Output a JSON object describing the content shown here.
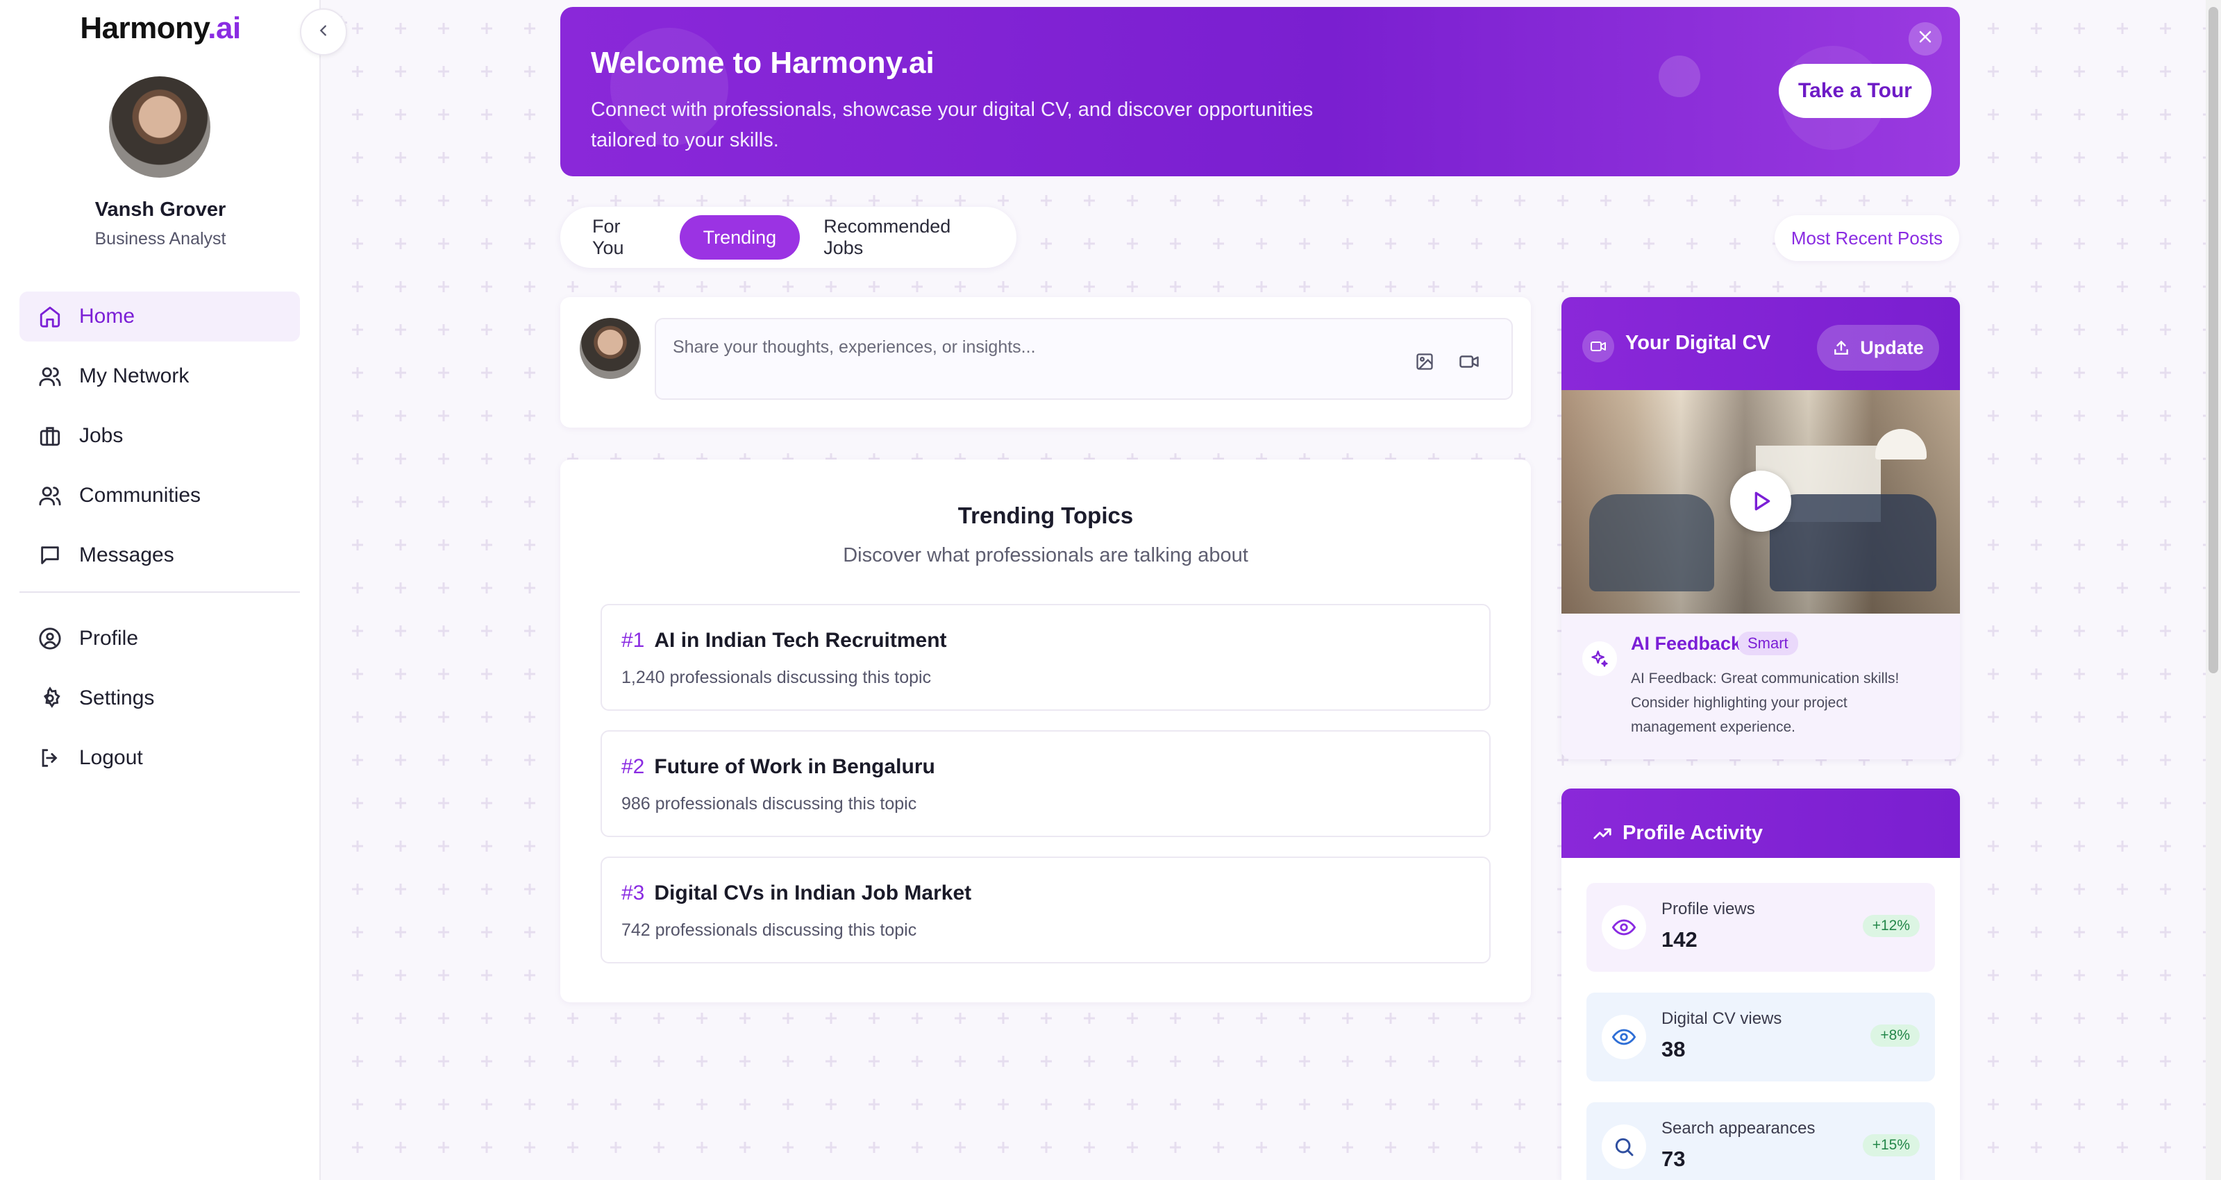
{
  "brand": {
    "name": "Harmony",
    "suffix": ".ai"
  },
  "user": {
    "name": "Vansh Grover",
    "role": "Business Analyst"
  },
  "nav": {
    "primary": [
      {
        "label": "Home",
        "icon": "home-icon",
        "active": true
      },
      {
        "label": "My Network",
        "icon": "users-icon"
      },
      {
        "label": "Jobs",
        "icon": "briefcase-icon"
      },
      {
        "label": "Communities",
        "icon": "users-icon"
      },
      {
        "label": "Messages",
        "icon": "message-square-icon"
      }
    ],
    "secondary": [
      {
        "label": "Profile",
        "icon": "user-circle-icon"
      },
      {
        "label": "Settings",
        "icon": "gear-icon"
      },
      {
        "label": "Logout",
        "icon": "logout-icon"
      }
    ]
  },
  "banner": {
    "title": "Welcome to Harmony.ai",
    "text": "Connect with professionals, showcase your digital CV, and discover opportunities tailored to your skills.",
    "cta": "Take a Tour"
  },
  "tabs": [
    {
      "label": "For You",
      "active": false
    },
    {
      "label": "Trending",
      "active": true
    },
    {
      "label": "Recommended Jobs",
      "active": false
    }
  ],
  "sort_button": "Most Recent Posts",
  "composer": {
    "placeholder": "Share your thoughts, experiences, or insights..."
  },
  "trending": {
    "title": "Trending Topics",
    "subtitle": "Discover what professionals are talking about",
    "topics": [
      {
        "rank": "#1",
        "title": "AI in Indian Tech Recruitment",
        "count": "1,240 professionals discussing this topic"
      },
      {
        "rank": "#2",
        "title": "Future of Work in Bengaluru",
        "count": "986 professionals discussing this topic"
      },
      {
        "rank": "#3",
        "title": "Digital CVs in Indian Job Market",
        "count": "742 professionals discussing this topic"
      }
    ]
  },
  "digital_cv": {
    "title": "Your Digital CV",
    "update_label": "Update",
    "feedback_label": "AI Feedback",
    "feedback_badge": "Smart",
    "feedback_text": "AI Feedback: Great communication skills! Consider highlighting your project management experience."
  },
  "activity": {
    "title": "Profile Activity",
    "stats": [
      {
        "label": "Profile views",
        "value": "142",
        "delta": "+12%",
        "icon": "eye-icon",
        "bg": "#f7f1fd"
      },
      {
        "label": "Digital CV views",
        "value": "38",
        "delta": "+8%",
        "icon": "eye-icon",
        "bg": "#eef4fd"
      },
      {
        "label": "Search appearances",
        "value": "73",
        "delta": "+15%",
        "icon": "search-icon",
        "bg": "#eef4fd"
      }
    ]
  },
  "colors": {
    "accent": "#8a2be2",
    "banner": "#7a1fd0",
    "positive": "#24874a"
  }
}
